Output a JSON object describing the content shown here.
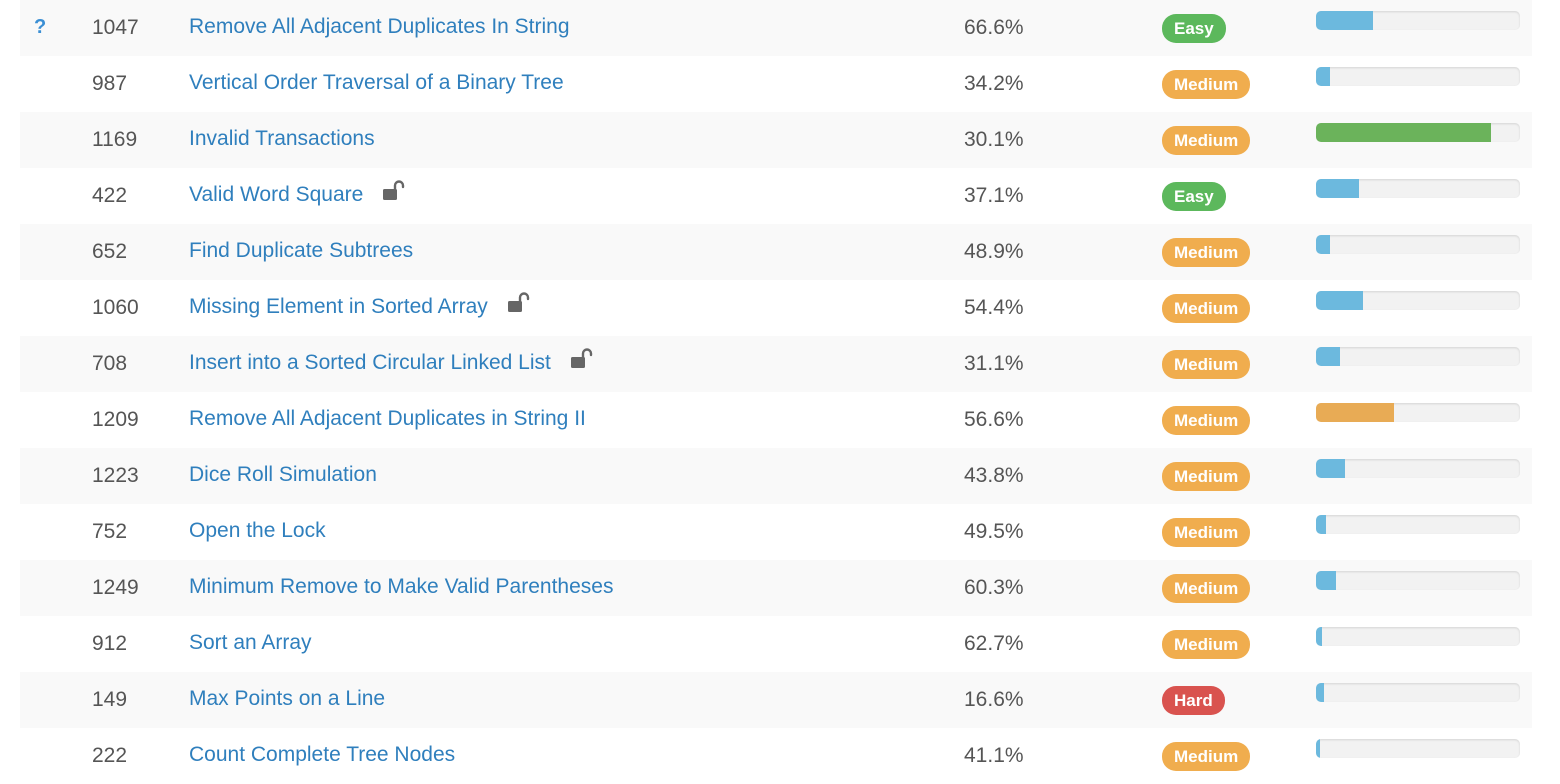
{
  "colors": {
    "link": "#2f7fbd",
    "easy": "#5cb85c",
    "medium": "#f0ad4e",
    "hard": "#d9534f",
    "bar_blue": "#6cb9de",
    "bar_green": "#6bb35b",
    "bar_orange": "#e8ab55"
  },
  "rows": [
    {
      "status": "?",
      "id": "1047",
      "title": "Remove All Adjacent Duplicates In String",
      "locked": false,
      "acceptance": "66.6%",
      "difficulty": "Easy",
      "difficulty_color": "#5cb85c",
      "frequency": 0.28,
      "frequency_color": "#6cb9de"
    },
    {
      "status": "",
      "id": "987",
      "title": "Vertical Order Traversal of a Binary Tree",
      "locked": false,
      "acceptance": "34.2%",
      "difficulty": "Medium",
      "difficulty_color": "#f0ad4e",
      "frequency": 0.07,
      "frequency_color": "#6cb9de"
    },
    {
      "status": "",
      "id": "1169",
      "title": "Invalid Transactions",
      "locked": false,
      "acceptance": "30.1%",
      "difficulty": "Medium",
      "difficulty_color": "#f0ad4e",
      "frequency": 0.86,
      "frequency_color": "#6bb35b"
    },
    {
      "status": "",
      "id": "422",
      "title": "Valid Word Square",
      "locked": true,
      "acceptance": "37.1%",
      "difficulty": "Easy",
      "difficulty_color": "#5cb85c",
      "frequency": 0.21,
      "frequency_color": "#6cb9de"
    },
    {
      "status": "",
      "id": "652",
      "title": "Find Duplicate Subtrees",
      "locked": false,
      "acceptance": "48.9%",
      "difficulty": "Medium",
      "difficulty_color": "#f0ad4e",
      "frequency": 0.07,
      "frequency_color": "#6cb9de"
    },
    {
      "status": "",
      "id": "1060",
      "title": "Missing Element in Sorted Array",
      "locked": true,
      "acceptance": "54.4%",
      "difficulty": "Medium",
      "difficulty_color": "#f0ad4e",
      "frequency": 0.23,
      "frequency_color": "#6cb9de"
    },
    {
      "status": "",
      "id": "708",
      "title": "Insert into a Sorted Circular Linked List",
      "locked": true,
      "acceptance": "31.1%",
      "difficulty": "Medium",
      "difficulty_color": "#f0ad4e",
      "frequency": 0.12,
      "frequency_color": "#6cb9de"
    },
    {
      "status": "",
      "id": "1209",
      "title": "Remove All Adjacent Duplicates in String II",
      "locked": false,
      "acceptance": "56.6%",
      "difficulty": "Medium",
      "difficulty_color": "#f0ad4e",
      "frequency": 0.38,
      "frequency_color": "#e8ab55"
    },
    {
      "status": "",
      "id": "1223",
      "title": "Dice Roll Simulation",
      "locked": false,
      "acceptance": "43.8%",
      "difficulty": "Medium",
      "difficulty_color": "#f0ad4e",
      "frequency": 0.14,
      "frequency_color": "#6cb9de"
    },
    {
      "status": "",
      "id": "752",
      "title": "Open the Lock",
      "locked": false,
      "acceptance": "49.5%",
      "difficulty": "Medium",
      "difficulty_color": "#f0ad4e",
      "frequency": 0.05,
      "frequency_color": "#6cb9de"
    },
    {
      "status": "",
      "id": "1249",
      "title": "Minimum Remove to Make Valid Parentheses",
      "locked": false,
      "acceptance": "60.3%",
      "difficulty": "Medium",
      "difficulty_color": "#f0ad4e",
      "frequency": 0.1,
      "frequency_color": "#6cb9de"
    },
    {
      "status": "",
      "id": "912",
      "title": "Sort an Array",
      "locked": false,
      "acceptance": "62.7%",
      "difficulty": "Medium",
      "difficulty_color": "#f0ad4e",
      "frequency": 0.03,
      "frequency_color": "#6cb9de"
    },
    {
      "status": "",
      "id": "149",
      "title": "Max Points on a Line",
      "locked": false,
      "acceptance": "16.6%",
      "difficulty": "Hard",
      "difficulty_color": "#d9534f",
      "frequency": 0.04,
      "frequency_color": "#6cb9de"
    },
    {
      "status": "",
      "id": "222",
      "title": "Count Complete Tree Nodes",
      "locked": false,
      "acceptance": "41.1%",
      "difficulty": "Medium",
      "difficulty_color": "#f0ad4e",
      "frequency": 0.02,
      "frequency_color": "#6cb9de"
    }
  ]
}
